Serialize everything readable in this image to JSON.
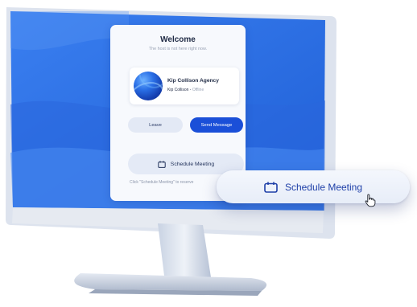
{
  "dialog": {
    "title": "Welcome",
    "subtitle": "The host is not here right now.",
    "host": {
      "name": "Kip Collison Agency",
      "person": "Kip Collison",
      "separator": " - ",
      "status": "Offline"
    },
    "leave_label": "Leave",
    "send_message_label": "Send Message",
    "schedule_label": "Schedule Meeting",
    "hint": "Click \"Schedule Meeting\" to reserve"
  },
  "callout": {
    "schedule_label": "Schedule Meeting"
  },
  "icons": {
    "calendar": "calendar-icon",
    "cursor": "hand-pointer-icon"
  },
  "colors": {
    "primary": "#1a4fd8",
    "screen_blue": "#2f6fe0",
    "card_bg": "#f7f9fd"
  }
}
